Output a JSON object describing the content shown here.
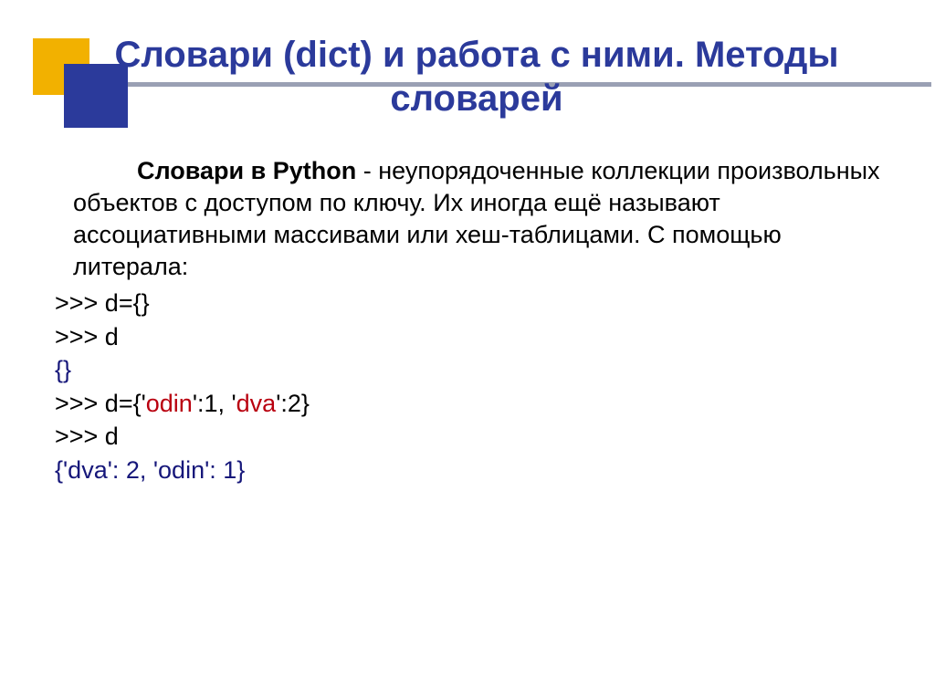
{
  "title": "Словари (dict) и работа с ними. Методы словарей",
  "paragraph": {
    "lead": "Словари в Python",
    "rest": " - неупорядоченные коллекции произвольных объектов с доступом по ключу. Их иногда ещё называют ассоциативными массивами или хеш-таблицами. С помощью литерала:"
  },
  "code": {
    "l1": ">>> d={}",
    "l2": ">>> d",
    "l3": "{}",
    "l4a": ">>> d={'",
    "l4b": "odin",
    "l4c": "':1, '",
    "l4d": "dva",
    "l4e": "':2}",
    "l5": ">>> d",
    "l6": "{'dva': 2, 'odin': 1}"
  }
}
